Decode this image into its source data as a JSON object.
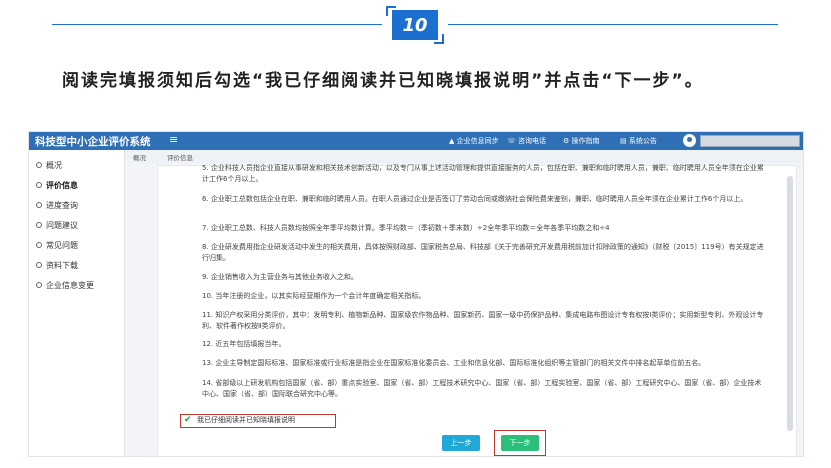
{
  "step": {
    "number": "10"
  },
  "instruction": "阅读完填报须知后勾选“我已仔细阅读并已知晓填报说明”并点击“下一步”。",
  "app": {
    "brand": "科技型中小企业评价系统",
    "menu_icon": "≡",
    "topbar": {
      "item1": "▲ 企业信息同步",
      "item2": "☏ 咨询电话",
      "item3": "⚙ 操作指南",
      "item4": "▤ 系统公告"
    },
    "tabs": {
      "tab1": "概况",
      "tab2": "评价信息"
    },
    "sidebar": {
      "items": [
        {
          "label": "概况"
        },
        {
          "label": "评价信息"
        },
        {
          "label": "进度查询"
        },
        {
          "label": "问题建议"
        },
        {
          "label": "常见问题"
        },
        {
          "label": "资料下载"
        },
        {
          "label": "企业信息变更"
        }
      ]
    },
    "content": {
      "items": [
        "5. 企业科技人员指企业直接从事研发和相关技术创新活动，以及专门从事上述活动管理和提供直接服务的人员，包括在职、兼职和临时聘用人员，兼职、临时聘用人员全年须在企业累计工作6个月以上。",
        "6. 企业职工总数包括企业在职、兼职和临时聘用人员。在职人员通过企业是否签订了劳动合同或缴纳社会保险费来鉴别，兼职、临时聘用人员全年须在企业累计工作6个月以上。",
        "7. 企业职工总数、科技人员数均按照全年季平均数计算。季平均数＝（季初数＋季末数）÷2全年季平均数＝全年各季平均数之和÷4",
        "8. 企业研发费用指企业研发活动中发生的相关费用，具体按照财政部、国家税务总局、科技部《关于完善研究开发费用税前加计扣除政策的通知》（财税〔2015〕119号）有关规定进行归集。",
        "9. 企业销售收入为主营业务与其他业务收入之和。",
        "10. 当年注册的企业，以其实际经营期作为一个会计年度确定相关指标。",
        "11. 知识产权采用分类评价，其中：发明专利、植物新品种、国家级农作物品种、国家新药、国家一级中药保护品种、集成电路布图设计专有权按Ⅰ类评价；实用新型专利、外观设计专利、软件著作权按Ⅱ类评价。",
        "12. 近五年包括填报当年。",
        "13. 企业主导制定国际标准、国家标准或行业标准是指企业在国家标准化委员会、工业和信息化部、国际标准化组织等主管部门的相关文件中排名起草单位前五名。",
        "14. 省部级以上研发机构包括国家（省、部）重点实验室、国家（省、部）工程技术研究中心、国家（省、部）工程实验室、国家（省、部）工程研究中心、国家（省、部）企业技术中心、国家（省、部）国际联合研究中心等。"
      ],
      "agree_label": "我已仔细阅读并已知晓填报说明",
      "check_mark": "✔",
      "prev_button": "上一步",
      "next_button": "下一步"
    }
  }
}
